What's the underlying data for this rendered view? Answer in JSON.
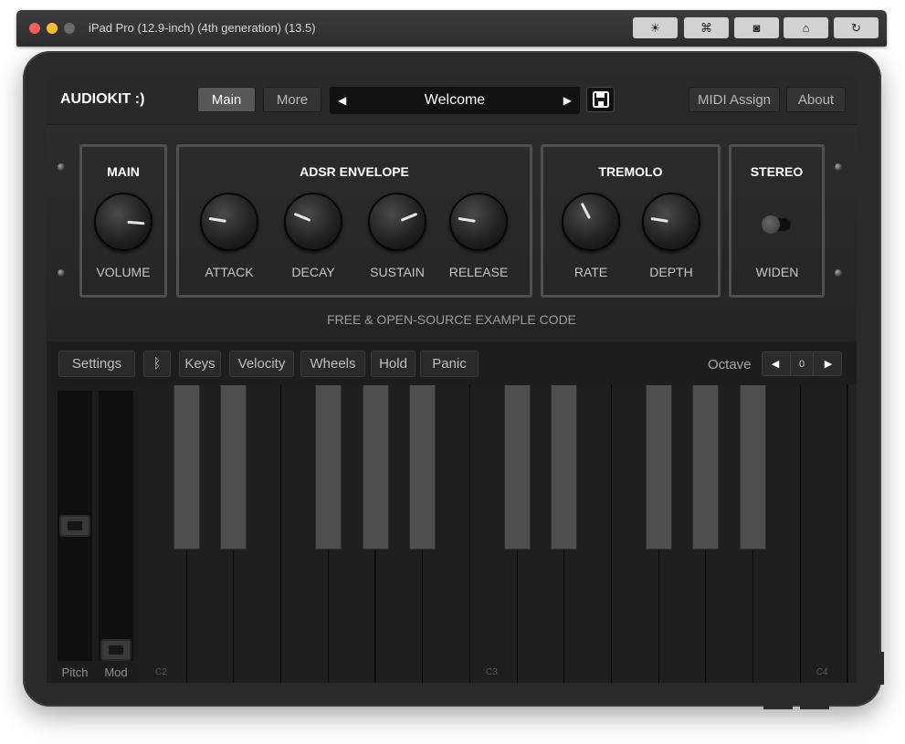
{
  "simulator": {
    "title": "iPad Pro (12.9-inch) (4th generation) (13.5)",
    "buttons": [
      {
        "icon": "brightness-icon",
        "glyph": "☀"
      },
      {
        "icon": "command-icon",
        "glyph": "⌘"
      },
      {
        "icon": "screenshot-icon",
        "glyph": "◙"
      },
      {
        "icon": "home-icon",
        "glyph": "⌂"
      },
      {
        "icon": "rotate-icon",
        "glyph": "↻"
      }
    ]
  },
  "app": {
    "brand": "AUDIOKIT :)",
    "tabs": [
      {
        "label": "Main",
        "active": true
      },
      {
        "label": "More",
        "active": false
      }
    ],
    "preset": {
      "name": "Welcome",
      "prev": "◀",
      "next": "▶"
    },
    "right_buttons": {
      "midi": "MIDI Assign",
      "about": "About"
    }
  },
  "panel": {
    "sections": {
      "main": {
        "title": "MAIN",
        "knobs": [
          {
            "label": "VOLUME",
            "value": 0.85
          }
        ]
      },
      "adsr": {
        "title": "ADSR ENVELOPE",
        "knobs": [
          {
            "label": "ATTACK",
            "value": 0.2
          },
          {
            "label": "DECAY",
            "value": 0.25
          },
          {
            "label": "SUSTAIN",
            "value": 0.75
          },
          {
            "label": "RELEASE",
            "value": 0.2
          }
        ]
      },
      "tremolo": {
        "title": "TREMOLO",
        "knobs": [
          {
            "label": "RATE",
            "value": 0.4
          },
          {
            "label": "DEPTH",
            "value": 0.2
          }
        ]
      },
      "stereo": {
        "title": "STEREO",
        "toggle_label": "WIDEN",
        "toggle_on": false
      }
    },
    "footer": "FREE & OPEN-SOURCE EXAMPLE CODE"
  },
  "keyboard_toolbar": {
    "settings": "Settings",
    "bluetooth_icon": "bluetooth-icon",
    "bluetooth_glyph": "ᛒ",
    "keys": "Keys",
    "velocity": "Velocity",
    "wheels": "Wheels",
    "hold": "Hold",
    "panic": "Panic",
    "octave_label": "Octave",
    "octave_value": "0"
  },
  "wheels": {
    "pitch_label": "Pitch",
    "mod_label": "Mod",
    "pitch_value": 0.5,
    "mod_value": 0.0
  },
  "piano": {
    "notes": [
      "C2",
      "C3",
      "C4"
    ]
  }
}
